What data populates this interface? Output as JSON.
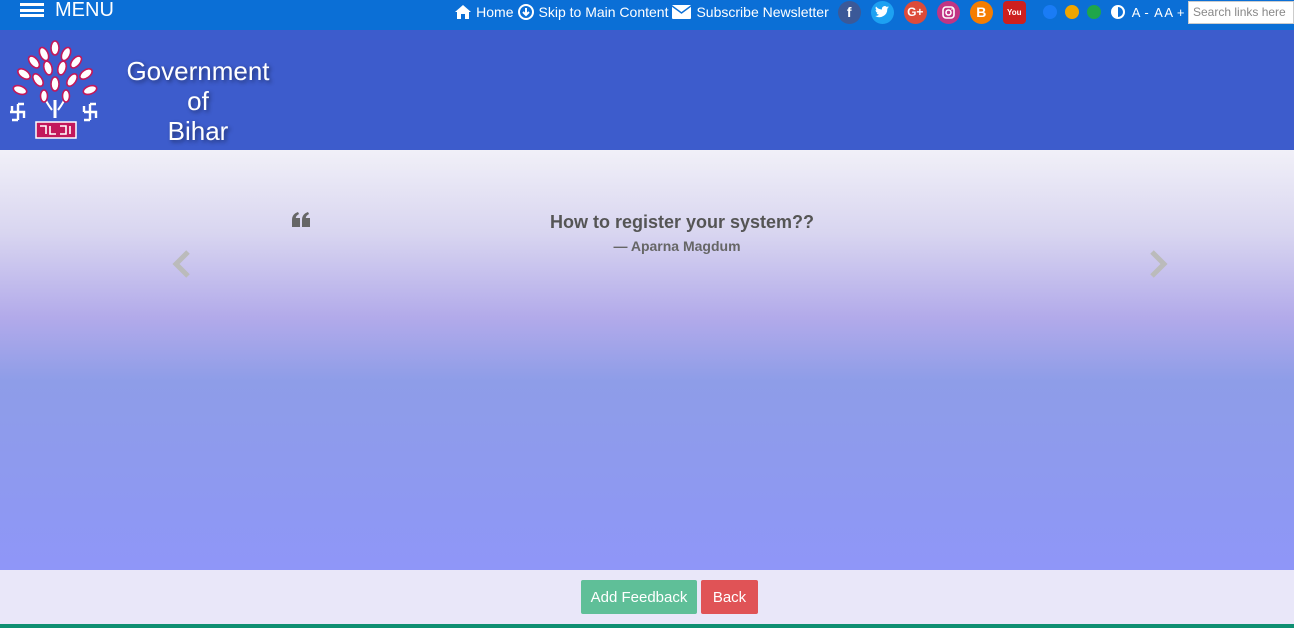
{
  "topbar": {
    "menu_label": "MENU",
    "links": {
      "home": "Home",
      "skip": "Skip to Main Content",
      "subscribe": "Subscribe Newsletter"
    },
    "social": {
      "facebook": "f",
      "twitter": "t",
      "google": "G+",
      "instagram": "ig",
      "blogger": "B",
      "youtube": "You"
    },
    "font_controls": {
      "decrease": "A -",
      "normal": "A",
      "increase": "A +"
    },
    "search_placeholder": "Search links here",
    "colors": {
      "bar": "#0b6fd6",
      "theme_blue": "#1a7cf5",
      "theme_orange": "#f0a500",
      "theme_green": "#1fa64b"
    }
  },
  "header": {
    "line1": "Government",
    "line2": "of",
    "line3": "Bihar",
    "background": "#3d5ccc"
  },
  "testimonial": {
    "quote": "How to register your system??",
    "author": "— Aparna Magdum"
  },
  "footer": {
    "add_feedback_label": "Add Feedback",
    "back_label": "Back",
    "colors": {
      "feedback": "#5fbf98",
      "back": "#e05356"
    }
  }
}
